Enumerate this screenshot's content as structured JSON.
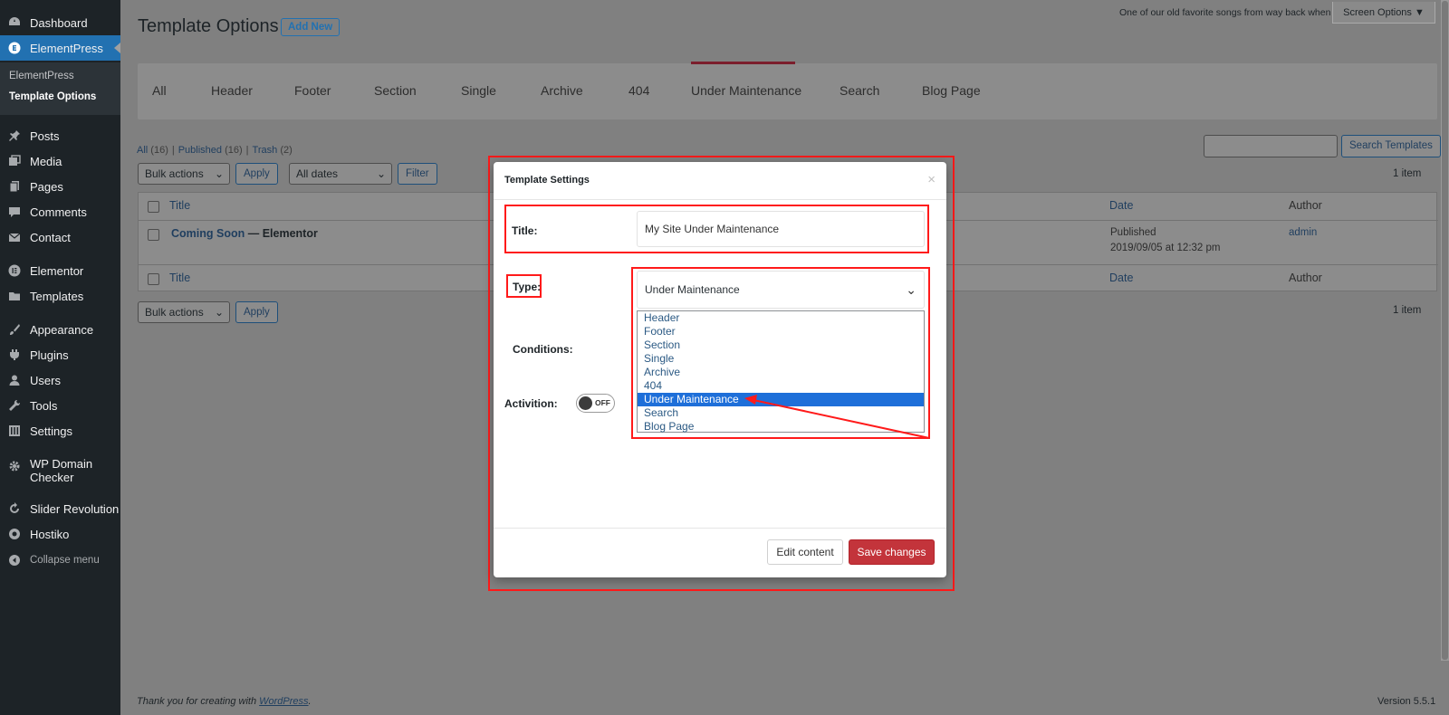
{
  "sidebar": {
    "items": [
      {
        "label": "Dashboard",
        "icon": "dashboard-icon"
      },
      {
        "label": "ElementPress",
        "icon": "elementpress-icon"
      },
      {
        "label": "Posts",
        "icon": "pin-icon"
      },
      {
        "label": "Media",
        "icon": "media-icon"
      },
      {
        "label": "Pages",
        "icon": "pages-icon"
      },
      {
        "label": "Comments",
        "icon": "comments-icon"
      },
      {
        "label": "Contact",
        "icon": "mail-icon"
      },
      {
        "label": "Elementor",
        "icon": "elementor-icon"
      },
      {
        "label": "Templates",
        "icon": "folder-icon"
      },
      {
        "label": "Appearance",
        "icon": "brush-icon"
      },
      {
        "label": "Plugins",
        "icon": "plugin-icon"
      },
      {
        "label": "Users",
        "icon": "user-icon"
      },
      {
        "label": "Tools",
        "icon": "wrench-icon"
      },
      {
        "label": "Settings",
        "icon": "settings-icon"
      },
      {
        "label": "WP Domain Checker",
        "icon": "gear-icon"
      },
      {
        "label": "Slider Revolution",
        "icon": "refresh-icon"
      },
      {
        "label": "Hostiko",
        "icon": "hostiko-icon"
      },
      {
        "label": "Collapse menu",
        "icon": "collapse-icon"
      }
    ],
    "submenu": [
      "ElementPress",
      "Template Options"
    ]
  },
  "header": {
    "title": "Template Options",
    "add_new": "Add New",
    "hello_dolly": "One of our old favorite songs from way back when",
    "screen_options": "Screen Options ▼"
  },
  "tabs": [
    "All",
    "Header",
    "Footer",
    "Section",
    "Single",
    "Archive",
    "404",
    "Under Maintenance",
    "Search",
    "Blog Page"
  ],
  "filters": {
    "all": "All",
    "all_count": "(16)",
    "published": "Published",
    "published_count": "(16)",
    "trash": "Trash",
    "trash_count": "(2)",
    "bulk_actions": "Bulk actions",
    "apply": "Apply",
    "all_dates": "All dates",
    "filter": "Filter",
    "search_button": "Search Templates",
    "items_count": "1 item"
  },
  "table": {
    "col_title": "Title",
    "col_date": "Date",
    "col_author": "Author",
    "row": {
      "title": "Coming Soon",
      "suffix": " — Elementor",
      "status": "Published",
      "date": "2019/09/05 at 12:32 pm",
      "author": "admin"
    }
  },
  "footer": {
    "thanks_prefix": "Thank you for creating with ",
    "wordpress": "WordPress",
    "thanks_suffix": ".",
    "version": "Version 5.5.1"
  },
  "modal": {
    "title": "Template Settings",
    "close": "×",
    "title_label": "Title:",
    "title_value": "My Site Under Maintenance",
    "type_label": "Type:",
    "type_value": "Under Maintenance",
    "type_options": [
      "Header",
      "Footer",
      "Section",
      "Single",
      "Archive",
      "404",
      "Under Maintenance",
      "Search",
      "Blog Page"
    ],
    "conditions_label": "Conditions:",
    "activation_label": "Activition:",
    "toggle_text": "OFF",
    "edit_content": "Edit content",
    "save_changes": "Save changes"
  },
  "colors": {
    "accent": "#2271b1",
    "save": "#c3343b",
    "highlight": "#ff1a1a",
    "tab_active": "#7b1e2c"
  }
}
